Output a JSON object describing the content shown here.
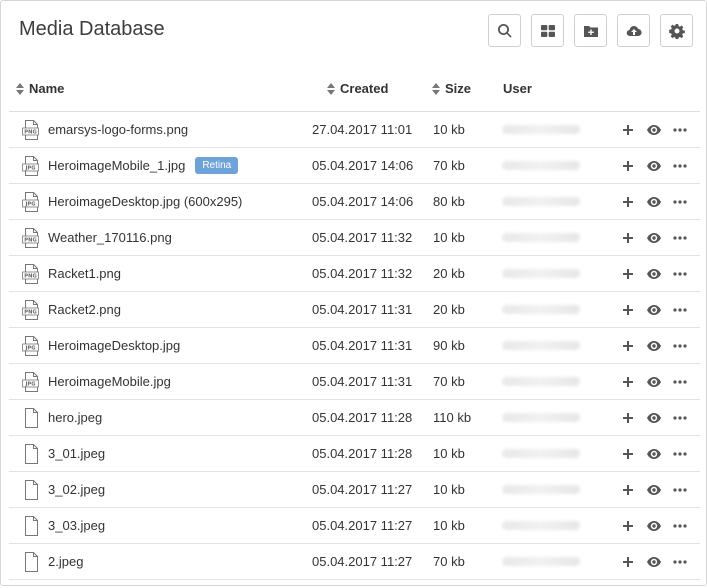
{
  "header": {
    "title": "Media Database",
    "toolbar": [
      {
        "icon": "search-icon"
      },
      {
        "icon": "grid-view-icon"
      },
      {
        "icon": "new-folder-icon"
      },
      {
        "icon": "cloud-upload-icon"
      },
      {
        "icon": "gear-icon"
      }
    ]
  },
  "table": {
    "columns": {
      "name": "Name",
      "created": "Created",
      "size": "Size",
      "user": "User"
    },
    "rows": [
      {
        "name": "emarsys-logo-forms.png",
        "icon": "png-file-icon",
        "created": "27.04.2017 11:01",
        "size": "10 kb"
      },
      {
        "name": "HeroimageMobile_1.jpg",
        "icon": "jpg-file-icon",
        "badge": "Retina",
        "created": "05.04.2017 14:06",
        "size": "70 kb"
      },
      {
        "name": "HeroimageDesktop.jpg (600x295)",
        "icon": "jpg-file-icon",
        "created": "05.04.2017 14:06",
        "size": "80 kb"
      },
      {
        "name": "Weather_170116.png",
        "icon": "png-file-icon",
        "created": "05.04.2017 11:32",
        "size": "10 kb"
      },
      {
        "name": "Racket1.png",
        "icon": "png-file-icon",
        "created": "05.04.2017 11:32",
        "size": "20 kb"
      },
      {
        "name": "Racket2.png",
        "icon": "png-file-icon",
        "created": "05.04.2017 11:31",
        "size": "20 kb"
      },
      {
        "name": "HeroimageDesktop.jpg",
        "icon": "jpg-file-icon",
        "created": "05.04.2017 11:31",
        "size": "90 kb"
      },
      {
        "name": "HeroimageMobile.jpg",
        "icon": "jpg-file-icon",
        "created": "05.04.2017 11:31",
        "size": "70 kb"
      },
      {
        "name": "hero.jpeg",
        "icon": "blank-file-icon",
        "created": "05.04.2017 11:28",
        "size": "110 kb"
      },
      {
        "name": "3_01.jpeg",
        "icon": "blank-file-icon",
        "created": "05.04.2017 11:28",
        "size": "10 kb"
      },
      {
        "name": "3_02.jpeg",
        "icon": "blank-file-icon",
        "created": "05.04.2017 11:27",
        "size": "10 kb"
      },
      {
        "name": "3_03.jpeg",
        "icon": "blank-file-icon",
        "created": "05.04.2017 11:27",
        "size": "10 kb"
      },
      {
        "name": "2.jpeg",
        "icon": "blank-file-icon",
        "created": "05.04.2017 11:27",
        "size": "70 kb"
      }
    ]
  },
  "file_type_labels": {
    "png": "PNG",
    "jpg": "JPG"
  },
  "row_actions": [
    "plus-icon",
    "eye-icon",
    "more-icon"
  ],
  "colors": {
    "badge": "#6ea3d9",
    "border": "#d6d6d6",
    "icon": "#555555"
  }
}
